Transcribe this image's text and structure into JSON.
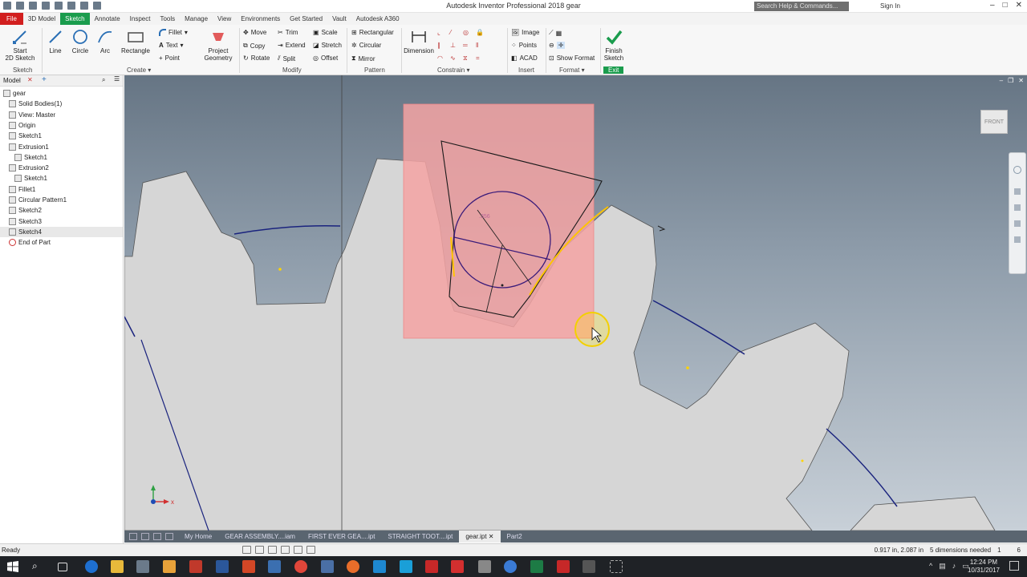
{
  "titlebar": {
    "title": "Autodesk Inventor Professional 2018   gear",
    "search_placeholder": "Search Help & Commands...",
    "sign_in": "Sign In"
  },
  "menu_tabs": [
    "File",
    "3D Model",
    "Sketch",
    "Annotate",
    "Inspect",
    "Tools",
    "Manage",
    "View",
    "Environments",
    "Get Started",
    "Vault",
    "Autodesk A360"
  ],
  "active_tab": "Sketch",
  "ribbon": {
    "sketch_panel": {
      "start_2d_sketch": "Start\n2D Sketch",
      "title": "Sketch"
    },
    "create": {
      "line": "Line",
      "circle": "Circle",
      "arc": "Arc",
      "rectangle": "Rectangle",
      "fillet": "Fillet",
      "text": "Text",
      "point": "Point",
      "project_geometry": "Project\nGeometry",
      "title": "Create"
    },
    "modify": {
      "move": "Move",
      "copy": "Copy",
      "rotate": "Rotate",
      "trim": "Trim",
      "extend": "Extend",
      "split": "Split",
      "scale": "Scale",
      "stretch": "Stretch",
      "offset": "Offset",
      "title": "Modify"
    },
    "pattern": {
      "rectangular": "Rectangular",
      "circular": "Circular",
      "mirror": "Mirror",
      "title": "Pattern"
    },
    "constrain": {
      "dimension": "Dimension",
      "title": "Constrain"
    },
    "insert": {
      "image": "Image",
      "points": "Points",
      "acad": "ACAD",
      "title": "Insert"
    },
    "format": {
      "show_format": "Show Format",
      "title": "Format"
    },
    "exit": {
      "finish_sketch": "Finish\nSketch",
      "title": "Exit"
    }
  },
  "browser": {
    "title": "Model",
    "items": [
      {
        "label": "gear",
        "indent": 0
      },
      {
        "label": "Solid Bodies(1)",
        "indent": 1
      },
      {
        "label": "View: Master",
        "indent": 1
      },
      {
        "label": "Origin",
        "indent": 1
      },
      {
        "label": "Sketch1",
        "indent": 1
      },
      {
        "label": "Extrusion1",
        "indent": 1
      },
      {
        "label": "Sketch1",
        "indent": 2
      },
      {
        "label": "Extrusion2",
        "indent": 1
      },
      {
        "label": "Sketch1",
        "indent": 2
      },
      {
        "label": "Fillet1",
        "indent": 1
      },
      {
        "label": "Circular Pattern1",
        "indent": 1
      },
      {
        "label": "Sketch2",
        "indent": 1
      },
      {
        "label": "Sketch3",
        "indent": 1
      },
      {
        "label": "Sketch4",
        "indent": 1,
        "selected": true
      },
      {
        "label": "End of Part",
        "indent": 1
      }
    ]
  },
  "viewcube_label": "FRONT",
  "dimension_text": ".356",
  "axis_x": "x",
  "doc_tabs": [
    "My Home",
    "GEAR ASSEMBLY....iam",
    "FIRST EVER GEA....ipt",
    "STRAIGHT TOOT....ipt",
    "gear.ipt",
    "Part2"
  ],
  "active_doc_tab": "gear.ipt",
  "status": {
    "left": "Ready",
    "coords": "0.917 in, 2.087 in",
    "dims_needed": "5 dimensions needed",
    "n1": "1",
    "n2": "6"
  },
  "clock": {
    "time": "12:24 PM",
    "date": "10/31/2017"
  },
  "colors": {
    "file_tab": "#d21f1f",
    "active_tab": "#1a9c4d",
    "selection_fill": "#f4a3a3",
    "sketch_line": "#1a237e",
    "highlight_curve": "#ffc400"
  }
}
